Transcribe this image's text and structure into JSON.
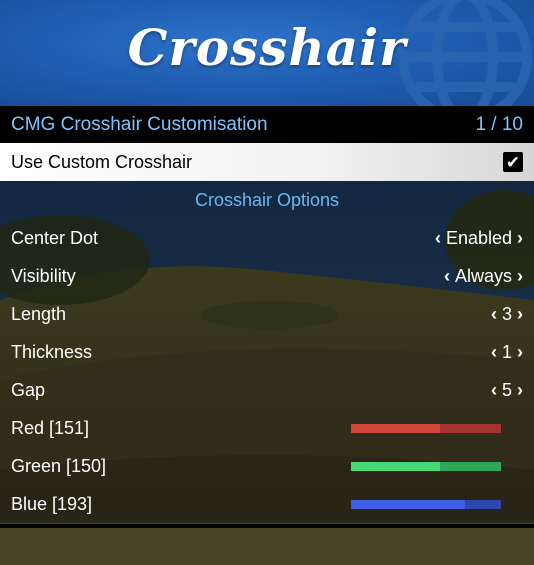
{
  "banner": {
    "title": "Crosshair"
  },
  "menu": {
    "title": "CMG Crosshair Customisation",
    "counter": "1 / 10"
  },
  "items": [
    {
      "label": "Use Custom Crosshair",
      "type": "checkbox",
      "checked": true,
      "check_glyph": "✔"
    },
    {
      "label": "Crosshair Options",
      "type": "header"
    },
    {
      "label": "Center Dot",
      "type": "list",
      "value": "Enabled"
    },
    {
      "label": "Visibility",
      "type": "list",
      "value": "Always"
    },
    {
      "label": "Length",
      "type": "list",
      "value": "3"
    },
    {
      "label": "Thickness",
      "type": "list",
      "value": "1"
    },
    {
      "label": "Gap",
      "type": "list",
      "value": "5"
    },
    {
      "label": "Red [151]",
      "type": "slider",
      "level": 0.59,
      "color": "#d2463b",
      "rest_color": "#a5342d"
    },
    {
      "label": "Green [150]",
      "type": "slider",
      "level": 0.59,
      "color": "#46d874",
      "rest_color": "#32a658"
    },
    {
      "label": "Blue [193]",
      "type": "slider",
      "level": 0.76,
      "color": "#3e5de2",
      "rest_color": "#2f47ad"
    }
  ],
  "arrows": {
    "left": "‹",
    "right": "›"
  },
  "colors": {
    "banner": "#1f5fb3",
    "subtitle_text": "#7fc4ff",
    "header_text": "#6ab8f0"
  }
}
